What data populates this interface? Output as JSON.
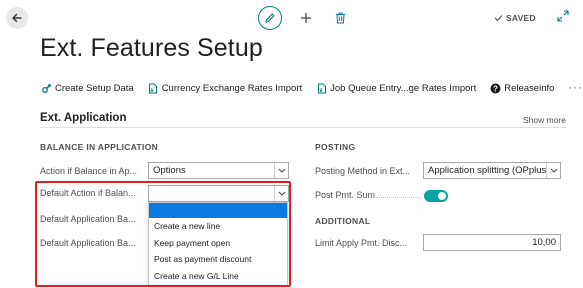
{
  "header": {
    "saved_label": "SAVED",
    "title": "Ext. Features Setup"
  },
  "actions": [
    {
      "label": "Create Setup Data",
      "icon": "gear-wrench-icon"
    },
    {
      "label": "Currency Exchange Rates Import",
      "icon": "document-import-icon"
    },
    {
      "label": "Job Queue Entry...ge Rates Import",
      "icon": "document-import-icon"
    },
    {
      "label": "Releaseinfo",
      "icon": "help-icon"
    }
  ],
  "section": {
    "title": "Ext. Application",
    "show_more": "Show more"
  },
  "balance": {
    "group_title": "BALANCE IN APPLICATION",
    "action_if_balance_label": "Action if Balance in Ap...",
    "action_if_balance_value": "Options",
    "default_action_label": "Default Action if Balan...",
    "default_action_value": "",
    "default_app_ba_label_1": "Default Application Ba...",
    "default_app_ba_label_2": "Default Application Ba..."
  },
  "dropdown": {
    "options": [
      "",
      "Create a new line",
      "Keep payment open",
      "Post as payment discount",
      "Create a new G/L Line"
    ]
  },
  "posting": {
    "group_title": "POSTING",
    "method_label": "Posting Method in Ext...",
    "method_value": "Application splitting (OPplus Sta",
    "post_pmt_sum_label": "Post Pmt. Sum",
    "post_pmt_sum_on": true
  },
  "additional": {
    "group_title": "ADDITIONAL",
    "limit_label": "Limit Apply Pmt. Disc...",
    "limit_value": "10,00"
  },
  "colors": {
    "accent": "#0a7a82",
    "toggle_on": "#0aa3a3",
    "selected_option": "#0a7ae0",
    "highlight": "#e02020"
  }
}
